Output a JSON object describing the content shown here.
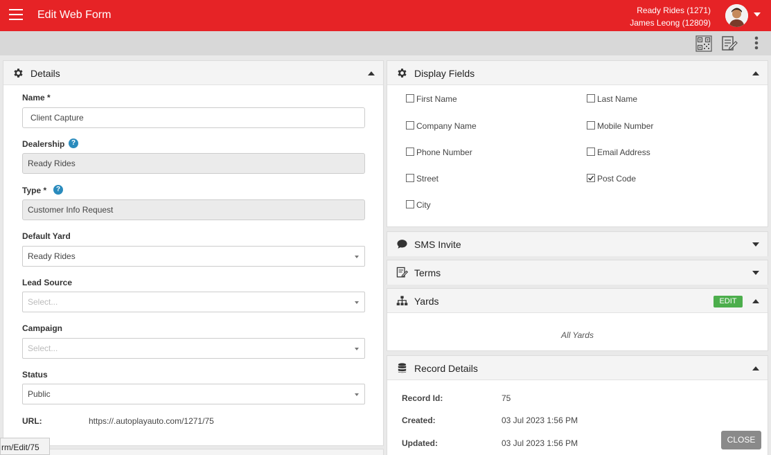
{
  "header": {
    "title": "Edit Web Form",
    "dealership_line": "Ready Rides (1271)",
    "user_line": "James Leong (12809)"
  },
  "toolbar": {
    "icons": [
      "qr-code-icon",
      "edit-note-icon",
      "more-vert-icon"
    ]
  },
  "details": {
    "title": "Details",
    "name_label": "Name *",
    "name_value": "Client Capture",
    "dealership_label": "Dealership",
    "dealership_value": "Ready Rides",
    "type_label": "Type *",
    "type_value": "Customer Info Request",
    "default_yard_label": "Default Yard",
    "default_yard_value": "Ready Rides",
    "lead_source_label": "Lead Source",
    "lead_source_placeholder": "Select...",
    "campaign_label": "Campaign",
    "campaign_placeholder": "Select...",
    "status_label": "Status",
    "status_value": "Public",
    "url_label": "URL:",
    "url_value": "https://.autoplayauto.com/1271/75"
  },
  "display_fields": {
    "title": "Display Fields",
    "fields": [
      {
        "label": "First Name",
        "checked": false
      },
      {
        "label": "Last Name",
        "checked": false
      },
      {
        "label": "Company Name",
        "checked": false
      },
      {
        "label": "Mobile Number",
        "checked": false
      },
      {
        "label": "Phone Number",
        "checked": false
      },
      {
        "label": "Email Address",
        "checked": false
      },
      {
        "label": "Street",
        "checked": false
      },
      {
        "label": "Post Code",
        "checked": true
      },
      {
        "label": "City",
        "checked": false
      }
    ]
  },
  "sms_invite": {
    "title": "SMS Invite"
  },
  "terms": {
    "title": "Terms"
  },
  "yards": {
    "title": "Yards",
    "edit_label": "EDIT",
    "content": "All Yards"
  },
  "record_details": {
    "title": "Record Details",
    "record_id_label": "Record Id:",
    "record_id_value": "75",
    "created_label": "Created:",
    "created_value": "03 Jul 2023 1:56 PM",
    "updated_label": "Updated:",
    "updated_value": "03 Jul 2023 1:56 PM"
  },
  "close_label": "CLOSE",
  "status_bar_url": "rm/Edit/75",
  "colors": {
    "brand_red": "#e62326",
    "help_blue": "#2a8bbd",
    "edit_green": "#4cae4c",
    "close_grey": "#8a8a8a"
  }
}
